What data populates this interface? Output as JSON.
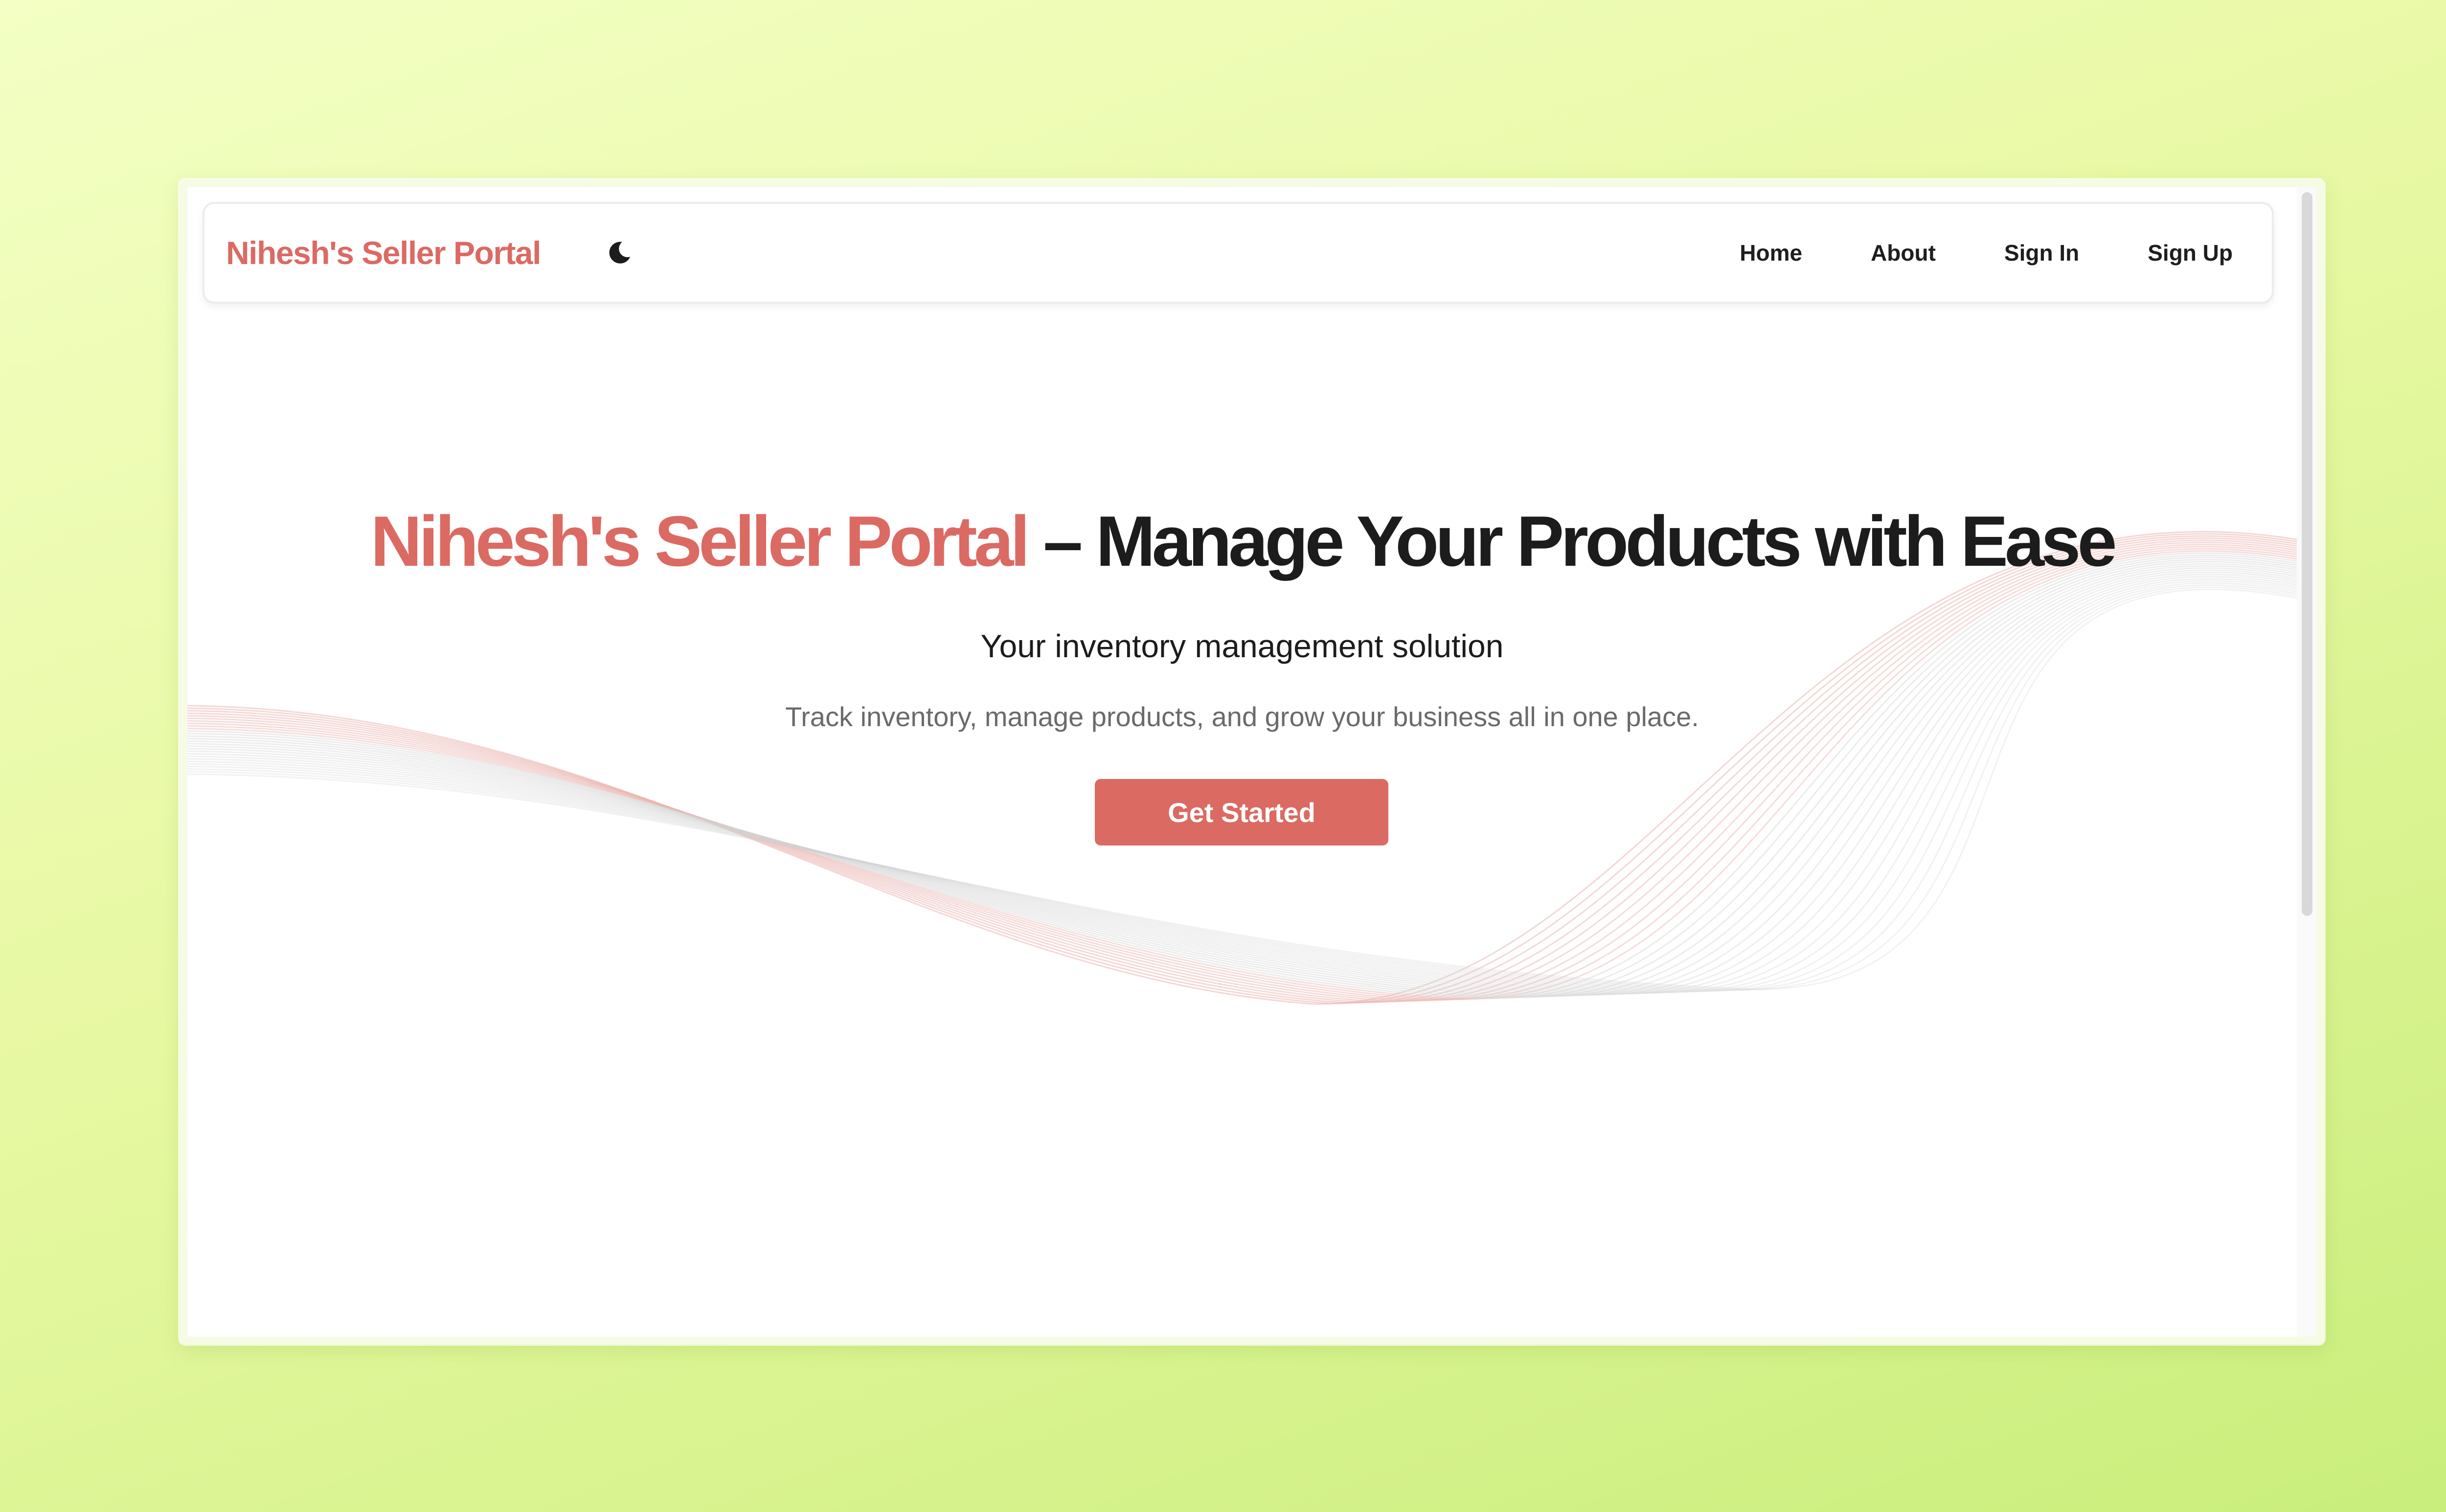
{
  "theme": {
    "accent": "#db6a63",
    "text": "#1c1c1c",
    "muted": "#6a6a6a"
  },
  "navbar": {
    "brand": "Nihesh's Seller Portal",
    "theme_toggle_icon": "moon-icon",
    "links": [
      "Home",
      "About",
      "Sign In",
      "Sign Up"
    ]
  },
  "hero": {
    "title_brand": "Nihesh's Seller Portal",
    "title_rest": " – Manage Your Products with Ease",
    "subtitle": "Your inventory management solution",
    "tagline": "Track inventory, manage products, and grow your business all in one place.",
    "cta_label": "Get Started"
  }
}
